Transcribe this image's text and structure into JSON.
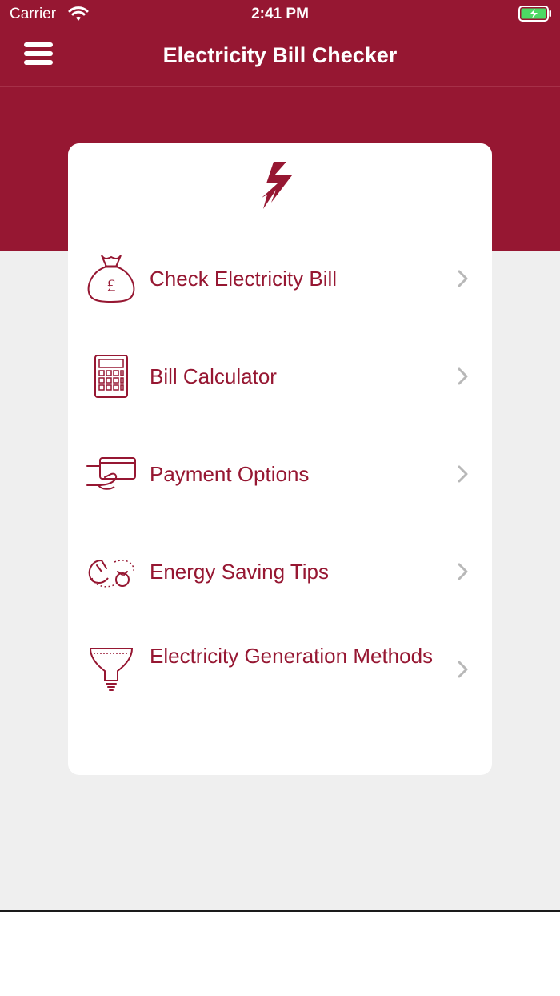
{
  "status_bar": {
    "carrier": "Carrier",
    "time": "2:41 PM"
  },
  "nav": {
    "title": "Electricity Bill Checker",
    "menu_icon": "hamburger-menu-icon"
  },
  "colors": {
    "brand": "#961732",
    "background": "#efefef",
    "card": "#ffffff",
    "chevron": "#b8b8b8",
    "battery": "#4cd964"
  },
  "card": {
    "logo_icon": "lightning-bolt-icon",
    "items": [
      {
        "label": "Check Electricity Bill",
        "icon": "money-bag-icon"
      },
      {
        "label": "Bill Calculator",
        "icon": "calculator-icon"
      },
      {
        "label": "Payment Options",
        "icon": "card-payment-icon"
      },
      {
        "label": "Energy Saving Tips",
        "icon": "plug-icon"
      },
      {
        "label": "Electricity Generation Methods",
        "icon": "bulb-icon"
      }
    ]
  }
}
